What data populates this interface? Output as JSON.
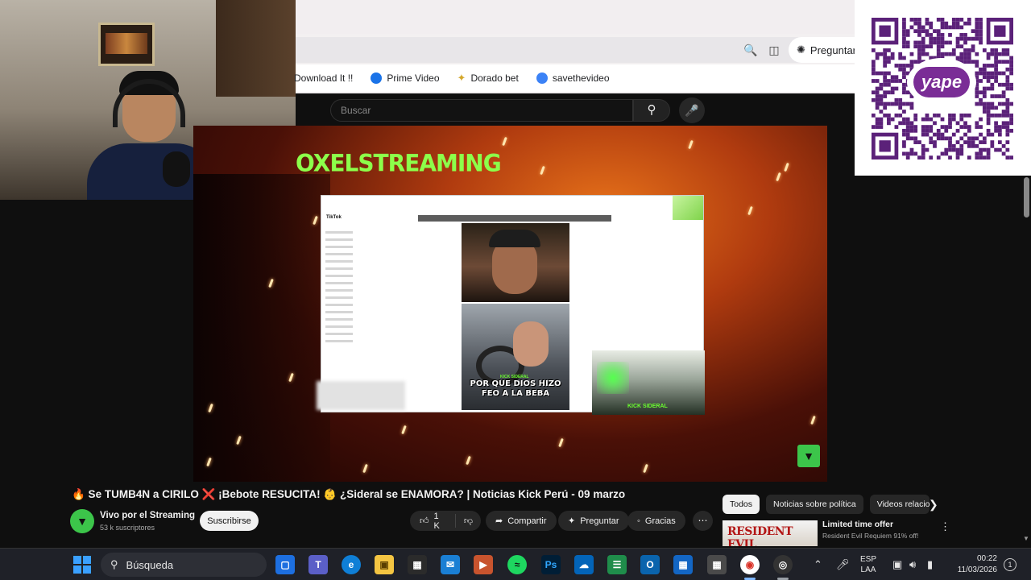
{
  "browser": {
    "ask_label": "Preguntar",
    "bookmarks": [
      {
        "label": "Download It !!",
        "color": "#ffffff"
      },
      {
        "label": "Prime Video",
        "color": "#1a73e8"
      },
      {
        "label": "Dorado bet",
        "color": "#d4a72c"
      },
      {
        "label": "savethevideo",
        "color": "#3b82f6"
      }
    ]
  },
  "youtube": {
    "search_placeholder": "Buscar",
    "video": {
      "banner_text": "OXELSTREAMING",
      "inner_caption": "POR QUE DIOS HIZO FEO A LA BEBA",
      "inner_kick_label": "KICK SIDERAL",
      "inner_app": "TikTok"
    },
    "title": "🔥 Se TUMB4N a CIRILO ❌ ¡Bebote RESUCITA! 👶 ¿Sideral se ENAMORA? | Noticias Kick Perú - 09 marzo",
    "channel": {
      "name": "Vivo por el Streaming",
      "subscribers": "53 k suscriptores",
      "subscribe_label": "Suscribirse"
    },
    "actions": {
      "likes": "1 K",
      "share": "Compartir",
      "ask": "Preguntar",
      "thanks": "Gracias"
    },
    "chips": [
      "Todos",
      "Noticias sobre política",
      "Videos relacio"
    ],
    "ad": {
      "thumb_text": "RESIDENT EVIL",
      "title": "Limited time offer",
      "description": "Resident Evil Requiem 91% off!"
    }
  },
  "qr": {
    "brand": "yape",
    "color": "#7a2d96"
  },
  "taskbar": {
    "search_label": "Búsqueda",
    "language": [
      "ESP",
      "LAA"
    ],
    "time": "00:22",
    "date": "11/03/2026"
  }
}
